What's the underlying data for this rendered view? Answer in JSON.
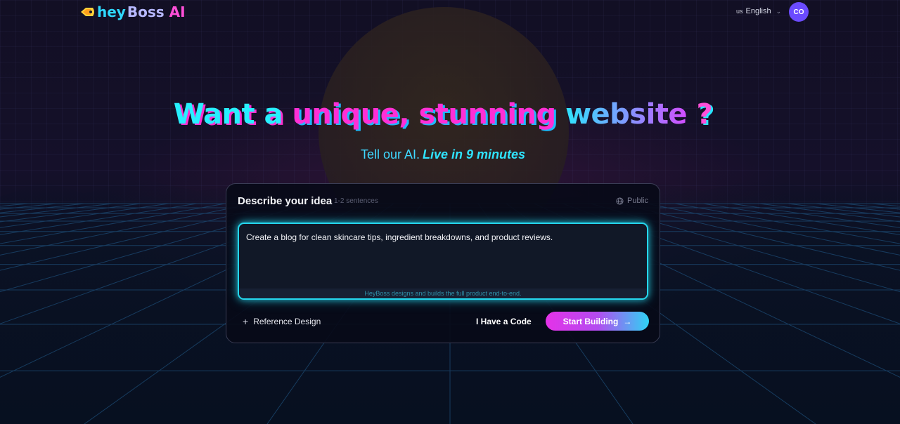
{
  "header": {
    "logo": {
      "hey": "hey",
      "boss": "Boss",
      "ai": "AI"
    },
    "language": {
      "flag": "us",
      "label": "English"
    },
    "avatar_initials": "CO"
  },
  "hero": {
    "headline": {
      "part1": "Want a ",
      "part2": "unique, stunning ",
      "part3": "website",
      "part4": " ?"
    },
    "subline": {
      "text": "Tell our AI.",
      "live": "Live in 9 minutes"
    }
  },
  "card": {
    "title": "Describe your idea",
    "hint": "1-2 sentences",
    "visibility": "Public",
    "prompt_value": "Create a blog for clean skincare tips, ingredient breakdowns, and product reviews.",
    "footer_note": "HeyBoss designs and builds the full product end-to-end.",
    "reference_label": "Reference Design",
    "code_label": "I Have a Code",
    "start_label": "Start Building"
  },
  "colors": {
    "accent_cyan": "#27f0ff",
    "accent_pink": "#ff2fd6",
    "avatar_bg": "#6b4bff"
  },
  "icons": [
    "plus-icon",
    "globe-icon",
    "arrow-right-icon",
    "chevron-down-icon"
  ]
}
